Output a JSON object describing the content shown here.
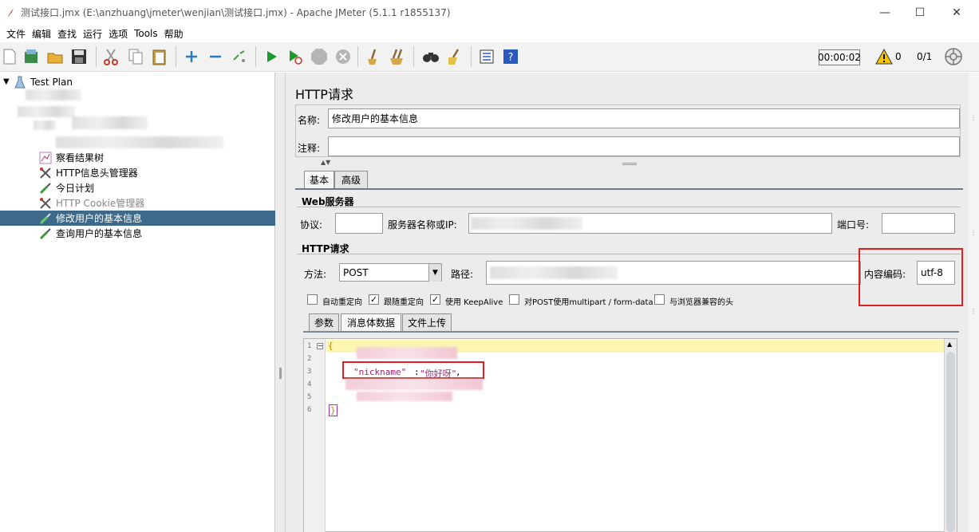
{
  "window": {
    "title": "测试接口.jmx (E:\\anzhuang\\jmeter\\wenjian\\测试接口.jmx) - Apache JMeter (5.1.1 r1855137)",
    "minimize": "—",
    "maximize": "☐",
    "close": "✕"
  },
  "menu": [
    "文件",
    "编辑",
    "查找",
    "运行",
    "选项",
    "Tools",
    "帮助"
  ],
  "toolbar": {
    "timer": "00:00:02",
    "warning_count": "0",
    "threads": "0/1"
  },
  "tree": {
    "root": "Test Plan",
    "items": [
      {
        "label": "察看结果树",
        "icon": "graph-icon"
      },
      {
        "label": "HTTP信息头管理器",
        "icon": "tools-icon"
      },
      {
        "label": "今日计划",
        "icon": "pipette-icon"
      },
      {
        "label": "HTTP Cookie管理器",
        "icon": "tools-icon"
      },
      {
        "label": "修改用户的基本信息",
        "icon": "pipette-icon"
      },
      {
        "label": "查询用户的基本信息",
        "icon": "pipette-icon"
      }
    ]
  },
  "panel": {
    "title": "HTTP请求",
    "name_label": "名称:",
    "name_value": "修改用户的基本信息",
    "comment_label": "注释:",
    "comment_value": "",
    "tabs": [
      "基本",
      "高级"
    ],
    "web_server_title": "Web服务器",
    "protocol_label": "协议:",
    "protocol_value": "",
    "server_label": "服务器名称或IP:",
    "port_label": "端口号:",
    "port_value": "",
    "http_request_title": "HTTP请求",
    "method_label": "方法:",
    "method_value": "POST",
    "path_label": "路径:",
    "encoding_label": "内容编码:",
    "encoding_value": "utf-8",
    "checkboxes": [
      {
        "label": "自动重定向",
        "checked": false
      },
      {
        "label": "跟随重定向",
        "checked": true
      },
      {
        "label": "使用 KeepAlive",
        "checked": true
      },
      {
        "label": "对POST使用multipart / form-data",
        "checked": false
      },
      {
        "label": "与浏览器兼容的头",
        "checked": false
      }
    ],
    "body_tabs": [
      "参数",
      "消息体数据",
      "文件上传"
    ],
    "editor": {
      "line_numbers": [
        "1",
        "2",
        "3",
        "4",
        "5",
        "6"
      ],
      "line1": "{",
      "line3_key": "\"nickname\"",
      "line3_colon": ":",
      "line3_value": "\"你好呀\"",
      "line3_comma": ",",
      "line6": "}"
    }
  },
  "colors": {
    "selected_row": "#3d6a8a",
    "highlight_box": "#e02020",
    "line_highlight": "#fbf7b2"
  }
}
